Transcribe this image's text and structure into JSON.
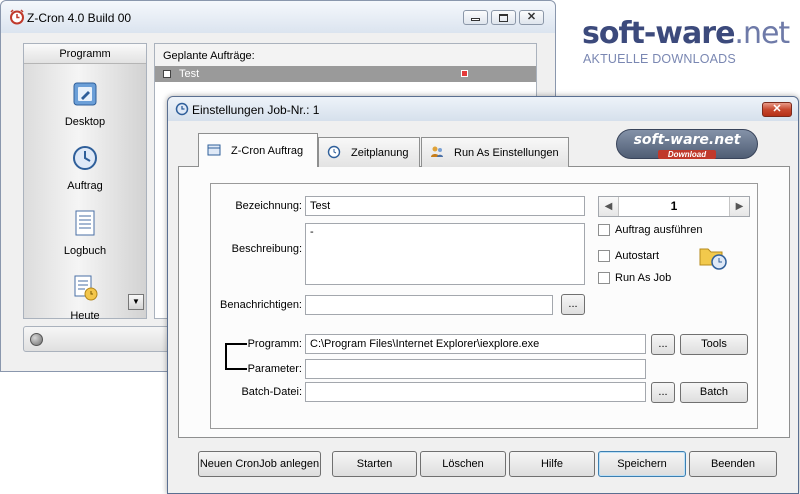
{
  "watermark": {
    "logo_main": "soft-ware",
    "logo_tld": ".net",
    "tagline": "AKTUELLE DOWNLOADS"
  },
  "main_window": {
    "title": "Z-Cron 4.0 Build 00",
    "sidebar": {
      "header": "Programm",
      "items": [
        {
          "label": "Desktop",
          "icon": "desktop-icon"
        },
        {
          "label": "Auftrag",
          "icon": "clock-icon"
        },
        {
          "label": "Logbuch",
          "icon": "logbook-icon"
        },
        {
          "label": "Heute",
          "icon": "today-icon"
        }
      ]
    },
    "job_list": {
      "header": "Geplante Aufträge:",
      "rows": [
        {
          "name": "Test"
        }
      ]
    }
  },
  "dialog": {
    "title": "Einstellungen Job-Nr.: 1",
    "brand": {
      "name": "soft-ware.net",
      "sub": "Download"
    },
    "tabs": [
      {
        "label": "Z-Cron Auftrag",
        "active": true
      },
      {
        "label": "Zeitplanung",
        "active": false
      },
      {
        "label": "Run As Einstellungen",
        "active": false
      }
    ],
    "form": {
      "bezeichnung_label": "Bezeichnung:",
      "bezeichnung_value": "Test",
      "beschreibung_label": "Beschreibung:",
      "beschreibung_value": "-",
      "benachrichtigen_label": "Benachrichtigen:",
      "benachrichtigen_value": "",
      "browse_label": "...",
      "job_number": "1",
      "spin_prev": "◀",
      "spin_next": "▶",
      "checkboxes": {
        "auftrag_ausfuehren": "Auftrag ausführen",
        "autostart": "Autostart",
        "run_as_job": "Run As Job"
      },
      "programm_label": "Programm:",
      "programm_value": "C:\\Program Files\\Internet Explorer\\iexplore.exe",
      "parameter_label": "Parameter:",
      "parameter_value": "",
      "batch_label": "Batch-Datei:",
      "batch_value": "",
      "tools_button": "Tools",
      "batch_button": "Batch"
    },
    "footer": {
      "new": "Neuen CronJob anlegen",
      "start": "Starten",
      "delete": "Löschen",
      "help": "Hilfe",
      "save": "Speichern",
      "quit": "Beenden"
    }
  }
}
